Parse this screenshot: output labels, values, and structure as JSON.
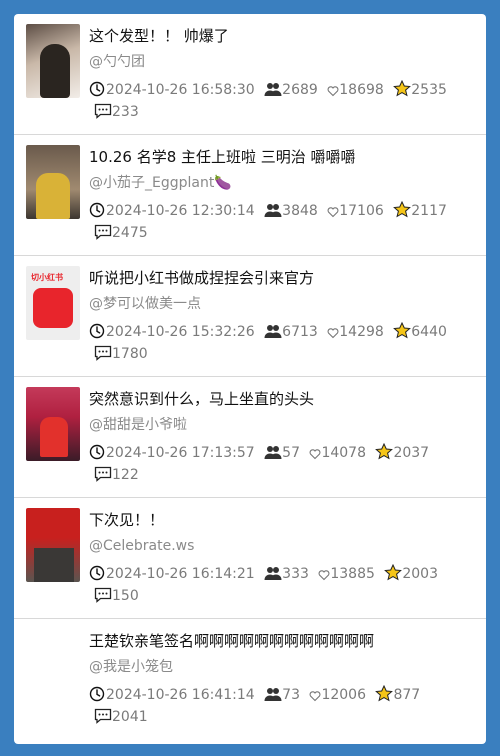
{
  "posts": [
    {
      "thumb": "t1",
      "title": "这个发型！！ 帅爆了",
      "author": "@勺勺团",
      "time": "2024-10-26 16:58:30",
      "people": "2689",
      "likes": "18698",
      "stars": "2535",
      "comments": "233"
    },
    {
      "thumb": "t2",
      "title": "10.26 名学8 主任上班啦 三明治 嚼嚼嚼",
      "author": "@小茄子_Eggplant🍆",
      "time": "2024-10-26 12:30:14",
      "people": "3848",
      "likes": "17106",
      "stars": "2117",
      "comments": "2475"
    },
    {
      "thumb": "t3",
      "thumb_text": "切小红书",
      "title": "听说把小红书做成捏捏会引来官方",
      "author": "@梦可以做美一点",
      "time": "2024-10-26 15:32:26",
      "people": "6713",
      "likes": "14298",
      "stars": "6440",
      "comments": "1780"
    },
    {
      "thumb": "t4",
      "title": "突然意识到什么，马上坐直的头头",
      "author": "@甜甜是小爷啦",
      "time": "2024-10-26 17:13:57",
      "people": "57",
      "likes": "14078",
      "stars": "2037",
      "comments": "122"
    },
    {
      "thumb": "t5",
      "title": "下次见！！",
      "author": "@Celebrate.ws",
      "time": "2024-10-26 16:14:21",
      "people": "333",
      "likes": "13885",
      "stars": "2003",
      "comments": "150"
    },
    {
      "thumb": "",
      "title": "王楚钦亲笔签名啊啊啊啊啊啊啊啊啊啊啊啊",
      "author": "@我是小笼包",
      "time": "2024-10-26 16:41:14",
      "people": "73",
      "likes": "12006",
      "stars": "877",
      "comments": "2041"
    }
  ],
  "icons": {
    "time": "clock-icon",
    "people": "people-icon",
    "likes": "heart-icon",
    "stars": "star-icon",
    "comments": "comment-icon"
  },
  "colors": {
    "background": "#3a7fbf",
    "star": "#f5c518"
  }
}
